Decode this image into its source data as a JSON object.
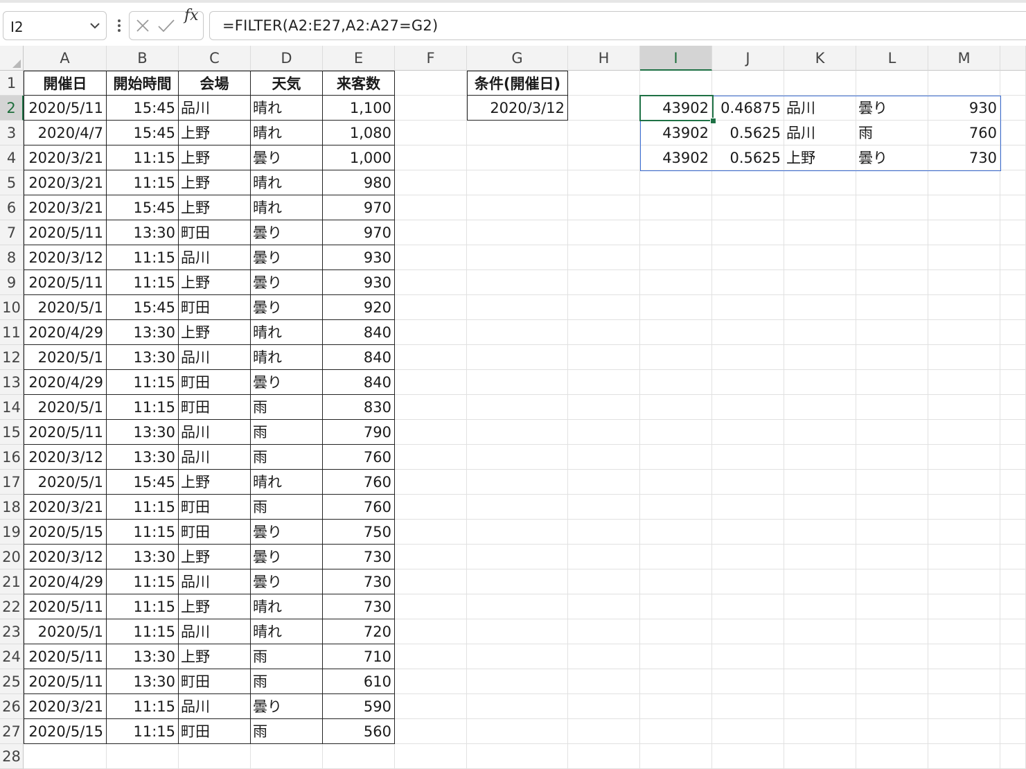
{
  "formula_bar": {
    "name_box": "I2",
    "formula": "=FILTER(A2:E27,A2:A27=G2)",
    "fx_label": "fx"
  },
  "columns": [
    "A",
    "B",
    "C",
    "D",
    "E",
    "F",
    "G",
    "H",
    "I",
    "J",
    "K",
    "L",
    "M"
  ],
  "rows": [
    "1",
    "2",
    "3",
    "4",
    "5",
    "6",
    "7",
    "8",
    "9",
    "10",
    "11",
    "12",
    "13",
    "14",
    "15",
    "16",
    "17",
    "18",
    "19",
    "20",
    "21",
    "22",
    "23",
    "24",
    "25",
    "26",
    "27",
    "28"
  ],
  "table": {
    "headers": [
      "開催日",
      "開始時間",
      "会場",
      "天気",
      "来客数"
    ],
    "data": [
      [
        "2020/5/11",
        "15:45",
        "品川",
        "晴れ",
        "1,100"
      ],
      [
        "2020/4/7",
        "15:45",
        "上野",
        "晴れ",
        "1,080"
      ],
      [
        "2020/3/21",
        "11:15",
        "上野",
        "曇り",
        "1,000"
      ],
      [
        "2020/3/21",
        "11:15",
        "上野",
        "晴れ",
        "980"
      ],
      [
        "2020/3/21",
        "15:45",
        "上野",
        "晴れ",
        "970"
      ],
      [
        "2020/5/11",
        "13:30",
        "町田",
        "曇り",
        "970"
      ],
      [
        "2020/3/12",
        "11:15",
        "品川",
        "曇り",
        "930"
      ],
      [
        "2020/5/11",
        "11:15",
        "上野",
        "曇り",
        "930"
      ],
      [
        "2020/5/1",
        "15:45",
        "町田",
        "曇り",
        "920"
      ],
      [
        "2020/4/29",
        "13:30",
        "上野",
        "晴れ",
        "840"
      ],
      [
        "2020/5/1",
        "13:30",
        "品川",
        "晴れ",
        "840"
      ],
      [
        "2020/4/29",
        "11:15",
        "町田",
        "曇り",
        "840"
      ],
      [
        "2020/5/1",
        "11:15",
        "町田",
        "雨",
        "830"
      ],
      [
        "2020/5/11",
        "13:30",
        "品川",
        "雨",
        "790"
      ],
      [
        "2020/3/12",
        "13:30",
        "品川",
        "雨",
        "760"
      ],
      [
        "2020/5/1",
        "15:45",
        "上野",
        "晴れ",
        "760"
      ],
      [
        "2020/3/21",
        "11:15",
        "町田",
        "雨",
        "760"
      ],
      [
        "2020/5/15",
        "11:15",
        "町田",
        "曇り",
        "750"
      ],
      [
        "2020/3/12",
        "13:30",
        "上野",
        "曇り",
        "730"
      ],
      [
        "2020/4/29",
        "11:15",
        "品川",
        "曇り",
        "730"
      ],
      [
        "2020/5/11",
        "11:15",
        "上野",
        "晴れ",
        "730"
      ],
      [
        "2020/5/1",
        "11:15",
        "品川",
        "晴れ",
        "720"
      ],
      [
        "2020/5/11",
        "13:30",
        "上野",
        "雨",
        "710"
      ],
      [
        "2020/5/11",
        "13:30",
        "町田",
        "雨",
        "610"
      ],
      [
        "2020/3/21",
        "11:15",
        "品川",
        "曇り",
        "590"
      ],
      [
        "2020/5/15",
        "11:15",
        "町田",
        "雨",
        "560"
      ]
    ]
  },
  "criteria": {
    "header": "条件(開催日)",
    "value": "2020/3/12"
  },
  "filter_result": [
    [
      "43902",
      "0.46875",
      "品川",
      "曇り",
      "930"
    ],
    [
      "43902",
      "0.5625",
      "品川",
      "雨",
      "760"
    ],
    [
      "43902",
      "0.5625",
      "上野",
      "曇り",
      "730"
    ]
  ],
  "selection": {
    "active_cell": "I2",
    "selected_column": "I",
    "selected_row": "2"
  },
  "colors": {
    "accent_green": "#1e7145",
    "spill_blue": "#3d6fd6"
  },
  "icons": [
    "chevron-down-icon",
    "more-options-icon",
    "cancel-icon",
    "enter-check-icon",
    "insert-function-icon"
  ]
}
